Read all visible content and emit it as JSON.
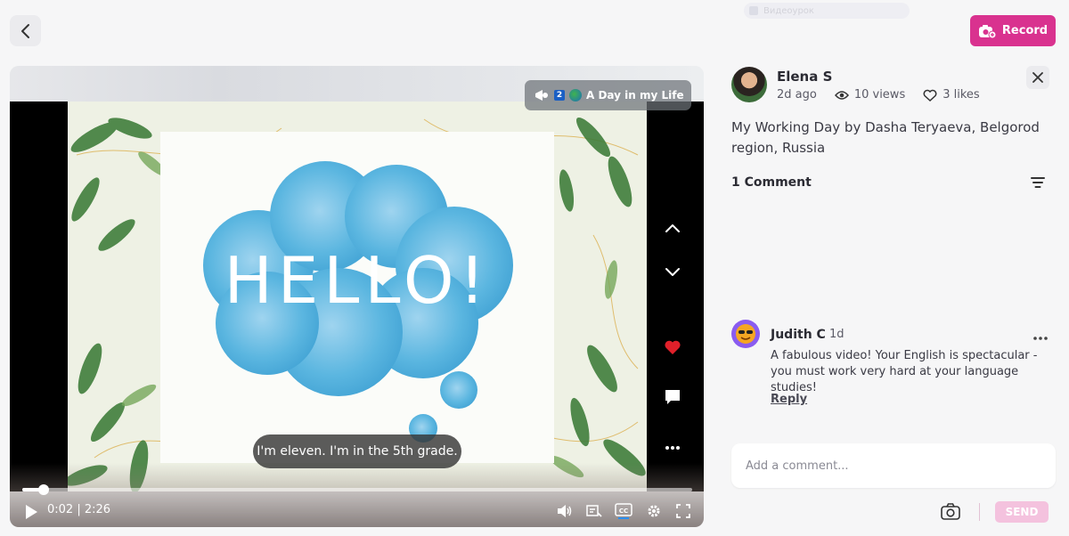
{
  "top_bar": {
    "record_label": "Record",
    "pill_text": "Видеоурок"
  },
  "video": {
    "tag_number": "2",
    "tag_title": "A Day in my Life",
    "frame_text": "HELLO!",
    "caption": "I'm eleven. I'm in the 5th grade.",
    "current_time": "0:02",
    "duration": "2:26",
    "time_display": "0:02 | 2:26",
    "progress": 0.015,
    "icons": {
      "up": "chevron-up-icon",
      "down": "chevron-down-icon",
      "like": "heart-icon",
      "comment": "comment-icon",
      "more": "more-icon",
      "play": "play-icon",
      "volume": "volume-icon",
      "transcript": "transcript-icon",
      "cc": "cc-icon",
      "settings": "gear-icon",
      "fullscreen": "fullscreen-icon"
    }
  },
  "post": {
    "author": "Elena S",
    "time_ago": "2d ago",
    "views": "10 views",
    "likes": "3 likes",
    "description": "My Working Day by Dasha Teryaeva, Belgorod region, Russia",
    "comments_count_label": "1 Comment"
  },
  "comments": [
    {
      "author": "Judith C",
      "time": "1d",
      "text": "A fabulous video!  Your English is spectacular - you must work very hard at your language studies!",
      "reply_label": "Reply"
    }
  ],
  "composer": {
    "placeholder": "Add a comment...",
    "send_label": "SEND"
  },
  "colors": {
    "accent": "#d9328f",
    "send_disabled": "#f4c2de",
    "like_red": "#e0202a",
    "cloud_blue": "#5bb6e0"
  }
}
